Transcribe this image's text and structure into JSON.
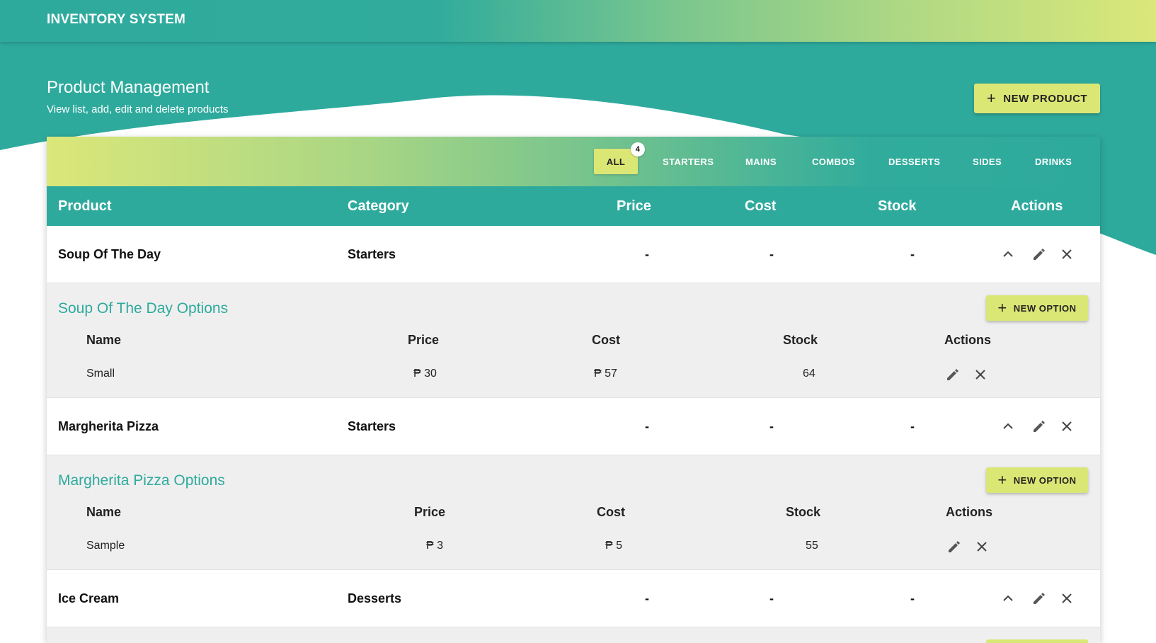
{
  "app": {
    "title": "INVENTORY SYSTEM"
  },
  "page": {
    "title": "Product Management",
    "subtitle": "View list, add, edit and delete products",
    "new_product_label": "NEW PRODUCT"
  },
  "colors": {
    "teal": "#2eaa9d",
    "lime": "#dbe775",
    "row_bg": "#ffffff",
    "options_bg": "#efefef"
  },
  "tabs": [
    {
      "label": "ALL",
      "active": true,
      "badge": "4"
    },
    {
      "label": "STARTERS"
    },
    {
      "label": "MAINS"
    },
    {
      "label": "COMBOS"
    },
    {
      "label": "DESSERTS"
    },
    {
      "label": "SIDES"
    },
    {
      "label": "DRINKS"
    }
  ],
  "table": {
    "headers": [
      "Product",
      "Category",
      "Price",
      "Cost",
      "Stock",
      "Actions"
    ]
  },
  "products": [
    {
      "name": "Soup Of The Day",
      "category": "Starters",
      "price": "-",
      "cost": "-",
      "stock": "-",
      "options": {
        "title": "Soup Of The Day Options",
        "new_option_label": "NEW OPTION",
        "headers": [
          "Name",
          "Price",
          "Cost",
          "Stock",
          "Actions"
        ],
        "rows": [
          {
            "name": "Small",
            "price": "₱ 30",
            "cost": "₱ 57",
            "stock": "64"
          }
        ]
      }
    },
    {
      "name": "Margherita Pizza",
      "category": "Starters",
      "price": "-",
      "cost": "-",
      "stock": "-",
      "options": {
        "title": "Margherita Pizza Options",
        "new_option_label": "NEW OPTION",
        "headers": [
          "Name",
          "Price",
          "Cost",
          "Stock",
          "Actions"
        ],
        "rows": [
          {
            "name": "Sample",
            "price": "₱ 3",
            "cost": "₱ 5",
            "stock": "55"
          }
        ]
      }
    },
    {
      "name": "Ice Cream",
      "category": "Desserts",
      "price": "-",
      "cost": "-",
      "stock": "-"
    }
  ],
  "icons": {
    "add": "plus-icon",
    "collapse": "chevron-up-icon",
    "edit": "pencil-icon",
    "delete": "close-icon"
  }
}
